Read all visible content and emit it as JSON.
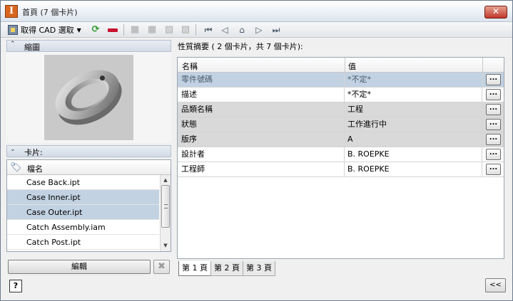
{
  "window": {
    "title": "首頁 (7 個卡片)",
    "close": "✕"
  },
  "toolbar": {
    "get_cad_label": "取得 CAD 選取",
    "dropdown": "▼",
    "help": "?"
  },
  "thumbnail_panel": {
    "label": "縮圖",
    "chevron": "⌃"
  },
  "cards_panel": {
    "label": "卡片:",
    "chevron": "⌄",
    "column": "檔名",
    "items": [
      {
        "name": "Case Back.ipt",
        "selected": false
      },
      {
        "name": "Case Inner.ipt",
        "selected": true
      },
      {
        "name": "Case Outer.ipt",
        "selected": true
      },
      {
        "name": "Catch Assembly.iam",
        "selected": false
      },
      {
        "name": "Catch Post.ipt",
        "selected": false
      }
    ]
  },
  "buttons": {
    "edit": "編輯",
    "delete": "✖",
    "collapse": "<<"
  },
  "summary": {
    "label": "性質摘要 ( 2 個卡片，共 7 個卡片):",
    "col_name": "名稱",
    "col_value": "值",
    "rows": [
      {
        "name": "零件號碼",
        "value": "*不定*",
        "style": "sel"
      },
      {
        "name": "描述",
        "value": "*不定*",
        "style": ""
      },
      {
        "name": "品類名稱",
        "value": "工程",
        "style": "shade"
      },
      {
        "name": "狀態",
        "value": "工作進行中",
        "style": "shade"
      },
      {
        "name": "版序",
        "value": "A",
        "style": "shade"
      },
      {
        "name": "設計者",
        "value": "B. ROEPKE",
        "style": ""
      },
      {
        "name": "工程師",
        "value": "B. ROEPKE",
        "style": ""
      }
    ],
    "dots": "..."
  },
  "tabs": [
    "第 1 頁",
    "第 2 頁",
    "第 3 頁"
  ],
  "colors": {
    "selection": "#c2d2e2",
    "shade": "#d9d9d9",
    "close": "#c0392b"
  }
}
